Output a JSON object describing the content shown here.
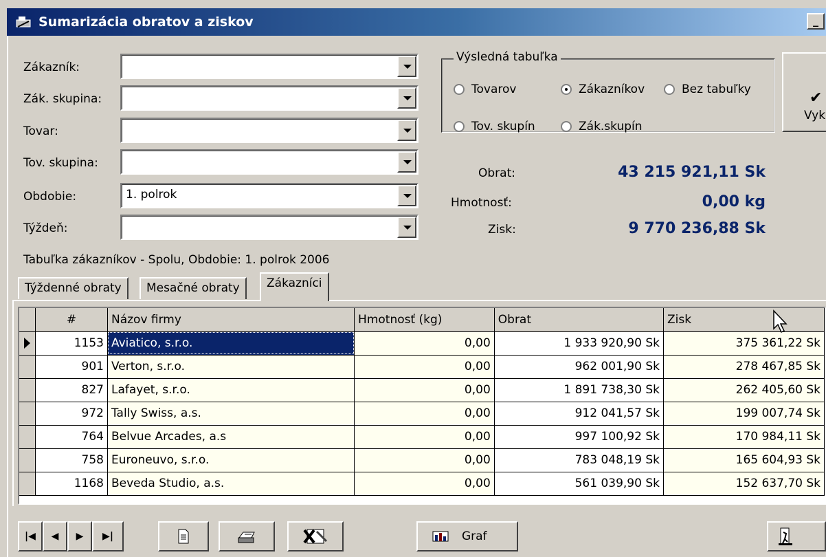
{
  "window": {
    "title": "Sumarizácia obratov a ziskov"
  },
  "filters": {
    "customer": {
      "label": "Zákazník:",
      "value": ""
    },
    "customer_group": {
      "label": "Zák. skupina:",
      "value": ""
    },
    "product": {
      "label": "Tovar:",
      "value": ""
    },
    "product_group": {
      "label": "Tov. skupina:",
      "value": ""
    },
    "period": {
      "label": "Obdobie:",
      "value": "1. polrok"
    },
    "week": {
      "label": "Týždeň:",
      "value": ""
    }
  },
  "result_table": {
    "legend": "Výsledná tabuľka",
    "options": {
      "products": "Tovarov",
      "customers": "Zákazníkov",
      "none": "Bez tabuľky",
      "product_groups": "Tov. skupín",
      "customer_groups": "Zák.skupín"
    },
    "selected": "customers"
  },
  "run_button": {
    "label": "Vyk"
  },
  "summary": {
    "turnover_label": "Obrat:",
    "turnover": "43 215 921,11 Sk",
    "weight_label": "Hmotnosť:",
    "weight": "0,00 kg",
    "profit_label": "Zisk:",
    "profit": "9 770 236,88 Sk"
  },
  "status_text": "Tabuľka zákazníkov - Spolu, Obdobie: 1. polrok 2006",
  "tabs": [
    "Týždenné obraty",
    "Mesačné obraty",
    "Zákazníci"
  ],
  "active_tab": 2,
  "grid": {
    "columns": [
      "#",
      "Názov firmy",
      "Hmotnosť (kg)",
      "Obrat",
      "Zisk"
    ],
    "rows": [
      {
        "id": "1153",
        "name": "Aviatico, s.r.o.",
        "weight": "0,00",
        "turnover": "1 933 920,90 Sk",
        "profit": "375 361,22 Sk"
      },
      {
        "id": "901",
        "name": "Verton, s.r.o.",
        "weight": "0,00",
        "turnover": "962 001,90 Sk",
        "profit": "278 467,85 Sk"
      },
      {
        "id": "827",
        "name": "Lafayet, s.r.o.",
        "weight": "0,00",
        "turnover": "1 891 738,30 Sk",
        "profit": "262 405,60 Sk"
      },
      {
        "id": "972",
        "name": "Tally Swiss, a.s.",
        "weight": "0,00",
        "turnover": "912 041,57 Sk",
        "profit": "199 007,74 Sk"
      },
      {
        "id": "764",
        "name": "Belvue Arcades, a.s",
        "weight": "0,00",
        "turnover": "997 100,92 Sk",
        "profit": "170 984,11 Sk"
      },
      {
        "id": "758",
        "name": "Euroneuvo, s.r.o.",
        "weight": "0,00",
        "turnover": "783 048,19 Sk",
        "profit": "165 604,93 Sk"
      },
      {
        "id": "1168",
        "name": "Beveda Studio, a.s.",
        "weight": "0,00",
        "turnover": "561 039,90 Sk",
        "profit": "152 637,70 Sk"
      }
    ]
  },
  "toolbar": {
    "chart_label": "Graf"
  }
}
